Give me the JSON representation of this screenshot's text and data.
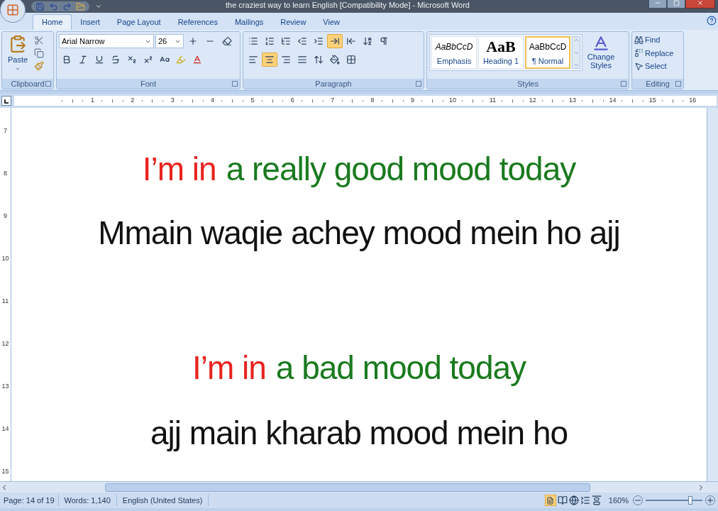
{
  "window": {
    "title": "the craziest way to learn English [Compatibility Mode] - Microsoft Word"
  },
  "tabs": [
    {
      "label": "Home",
      "selected": true
    },
    {
      "label": "Insert",
      "selected": false
    },
    {
      "label": "Page Layout",
      "selected": false
    },
    {
      "label": "References",
      "selected": false
    },
    {
      "label": "Mailings",
      "selected": false
    },
    {
      "label": "Review",
      "selected": false
    },
    {
      "label": "View",
      "selected": false
    }
  ],
  "clipboard": {
    "paste": "Paste",
    "group": "Clipboard"
  },
  "font": {
    "name": "Arial Narrow",
    "size": "26",
    "group": "Font"
  },
  "paragraph": {
    "group": "Paragraph",
    "align_buttons": [
      {
        "selected": false
      },
      {
        "selected": true
      },
      {
        "selected": false
      },
      {
        "selected": false
      }
    ],
    "direction_buttons": [
      {
        "selected": true
      },
      {
        "selected": false
      }
    ]
  },
  "styles": {
    "group": "Styles",
    "items": [
      {
        "kind": "italic",
        "preview": "AaBbCcD",
        "label": "Emphasis",
        "selected": false
      },
      {
        "kind": "heading",
        "preview": "AaB",
        "label": "Heading 1",
        "selected": false
      },
      {
        "kind": "normal",
        "preview": "AaBbCcD",
        "label": "¶ Normal",
        "selected": true
      }
    ],
    "change": [
      "Change",
      "Styles"
    ]
  },
  "editing": {
    "group": "Editing",
    "find": "Find",
    "replace": "Replace",
    "select": "Select"
  },
  "ruler": {
    "horizontal": [
      "1",
      "2",
      "3",
      "4",
      "5",
      "6",
      "7",
      "8",
      "9",
      "10",
      "11",
      "12",
      "13",
      "14",
      "15",
      "16"
    ],
    "vertical": [
      "7",
      "8",
      "9",
      "10",
      "11",
      "12",
      "13",
      "14",
      "15"
    ]
  },
  "document": {
    "lines": [
      {
        "segments": [
          {
            "text": "I’m in",
            "color": "#e8231f"
          },
          {
            "text": "a really good mood today",
            "color": "#1a7a1f"
          }
        ]
      },
      {
        "segments": [
          {
            "text": "Mmain waqie achey mood mein ho ajj",
            "color": "#111111"
          }
        ]
      },
      {
        "segments": [
          {
            "text": "I’m in",
            "color": "#e8231f"
          },
          {
            "text": "a bad mood today",
            "color": "#1a7a1f"
          }
        ]
      },
      {
        "segments": [
          {
            "text": "ajj main kharab mood mein ho",
            "color": "#111111"
          }
        ]
      }
    ]
  },
  "status_bar": {
    "page": "Page: 14 of 19",
    "words": "Words: 1,140",
    "language": "English (United States)",
    "zoom": "160%",
    "zoom_slider": {
      "level": 0.79
    }
  }
}
